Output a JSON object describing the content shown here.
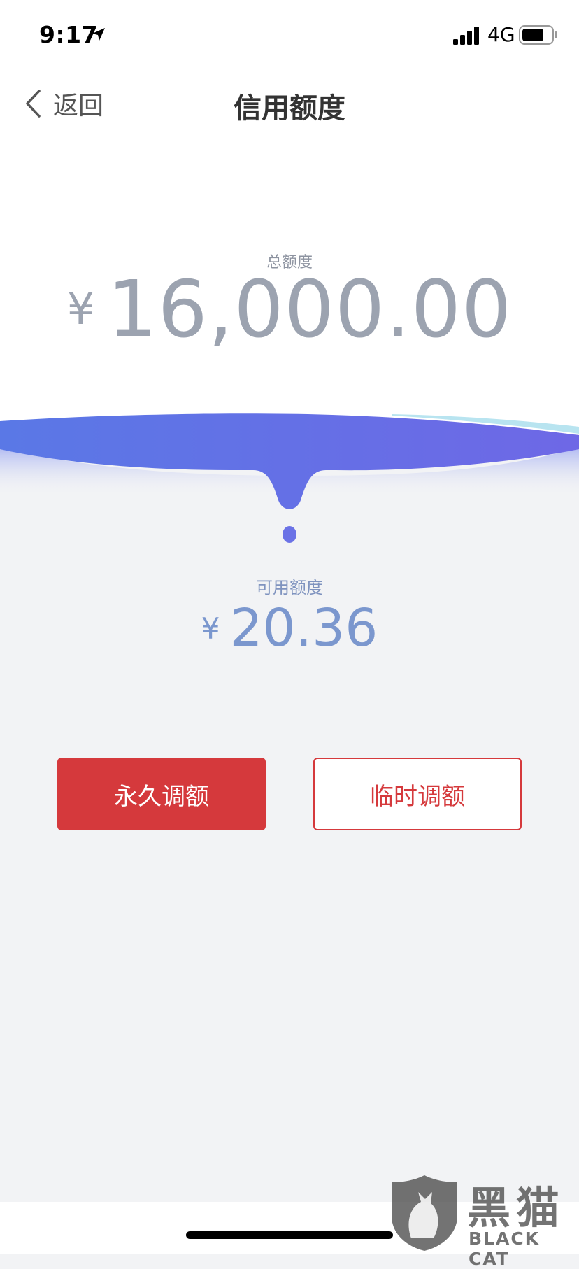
{
  "status_bar": {
    "time": "9:17",
    "network": "4G",
    "icons": [
      "location-arrow-icon",
      "signal-bars-icon",
      "battery-icon"
    ]
  },
  "nav": {
    "back_label": "返回",
    "title": "信用额度"
  },
  "total": {
    "label": "总额度",
    "currency": "¥",
    "amount": "16,000.00"
  },
  "available": {
    "label": "可用额度",
    "currency": "¥",
    "amount": "20.36"
  },
  "buttons": {
    "permanent_label": "永久调额",
    "temporary_label": "临时调额"
  },
  "watermark": {
    "cn": "黑猫",
    "en": "BLACK CAT"
  },
  "colors": {
    "wave_start": "#5a78e6",
    "wave_end": "#6e68e6",
    "button_red": "#d5393c",
    "amount_blue": "#7b97ce"
  }
}
